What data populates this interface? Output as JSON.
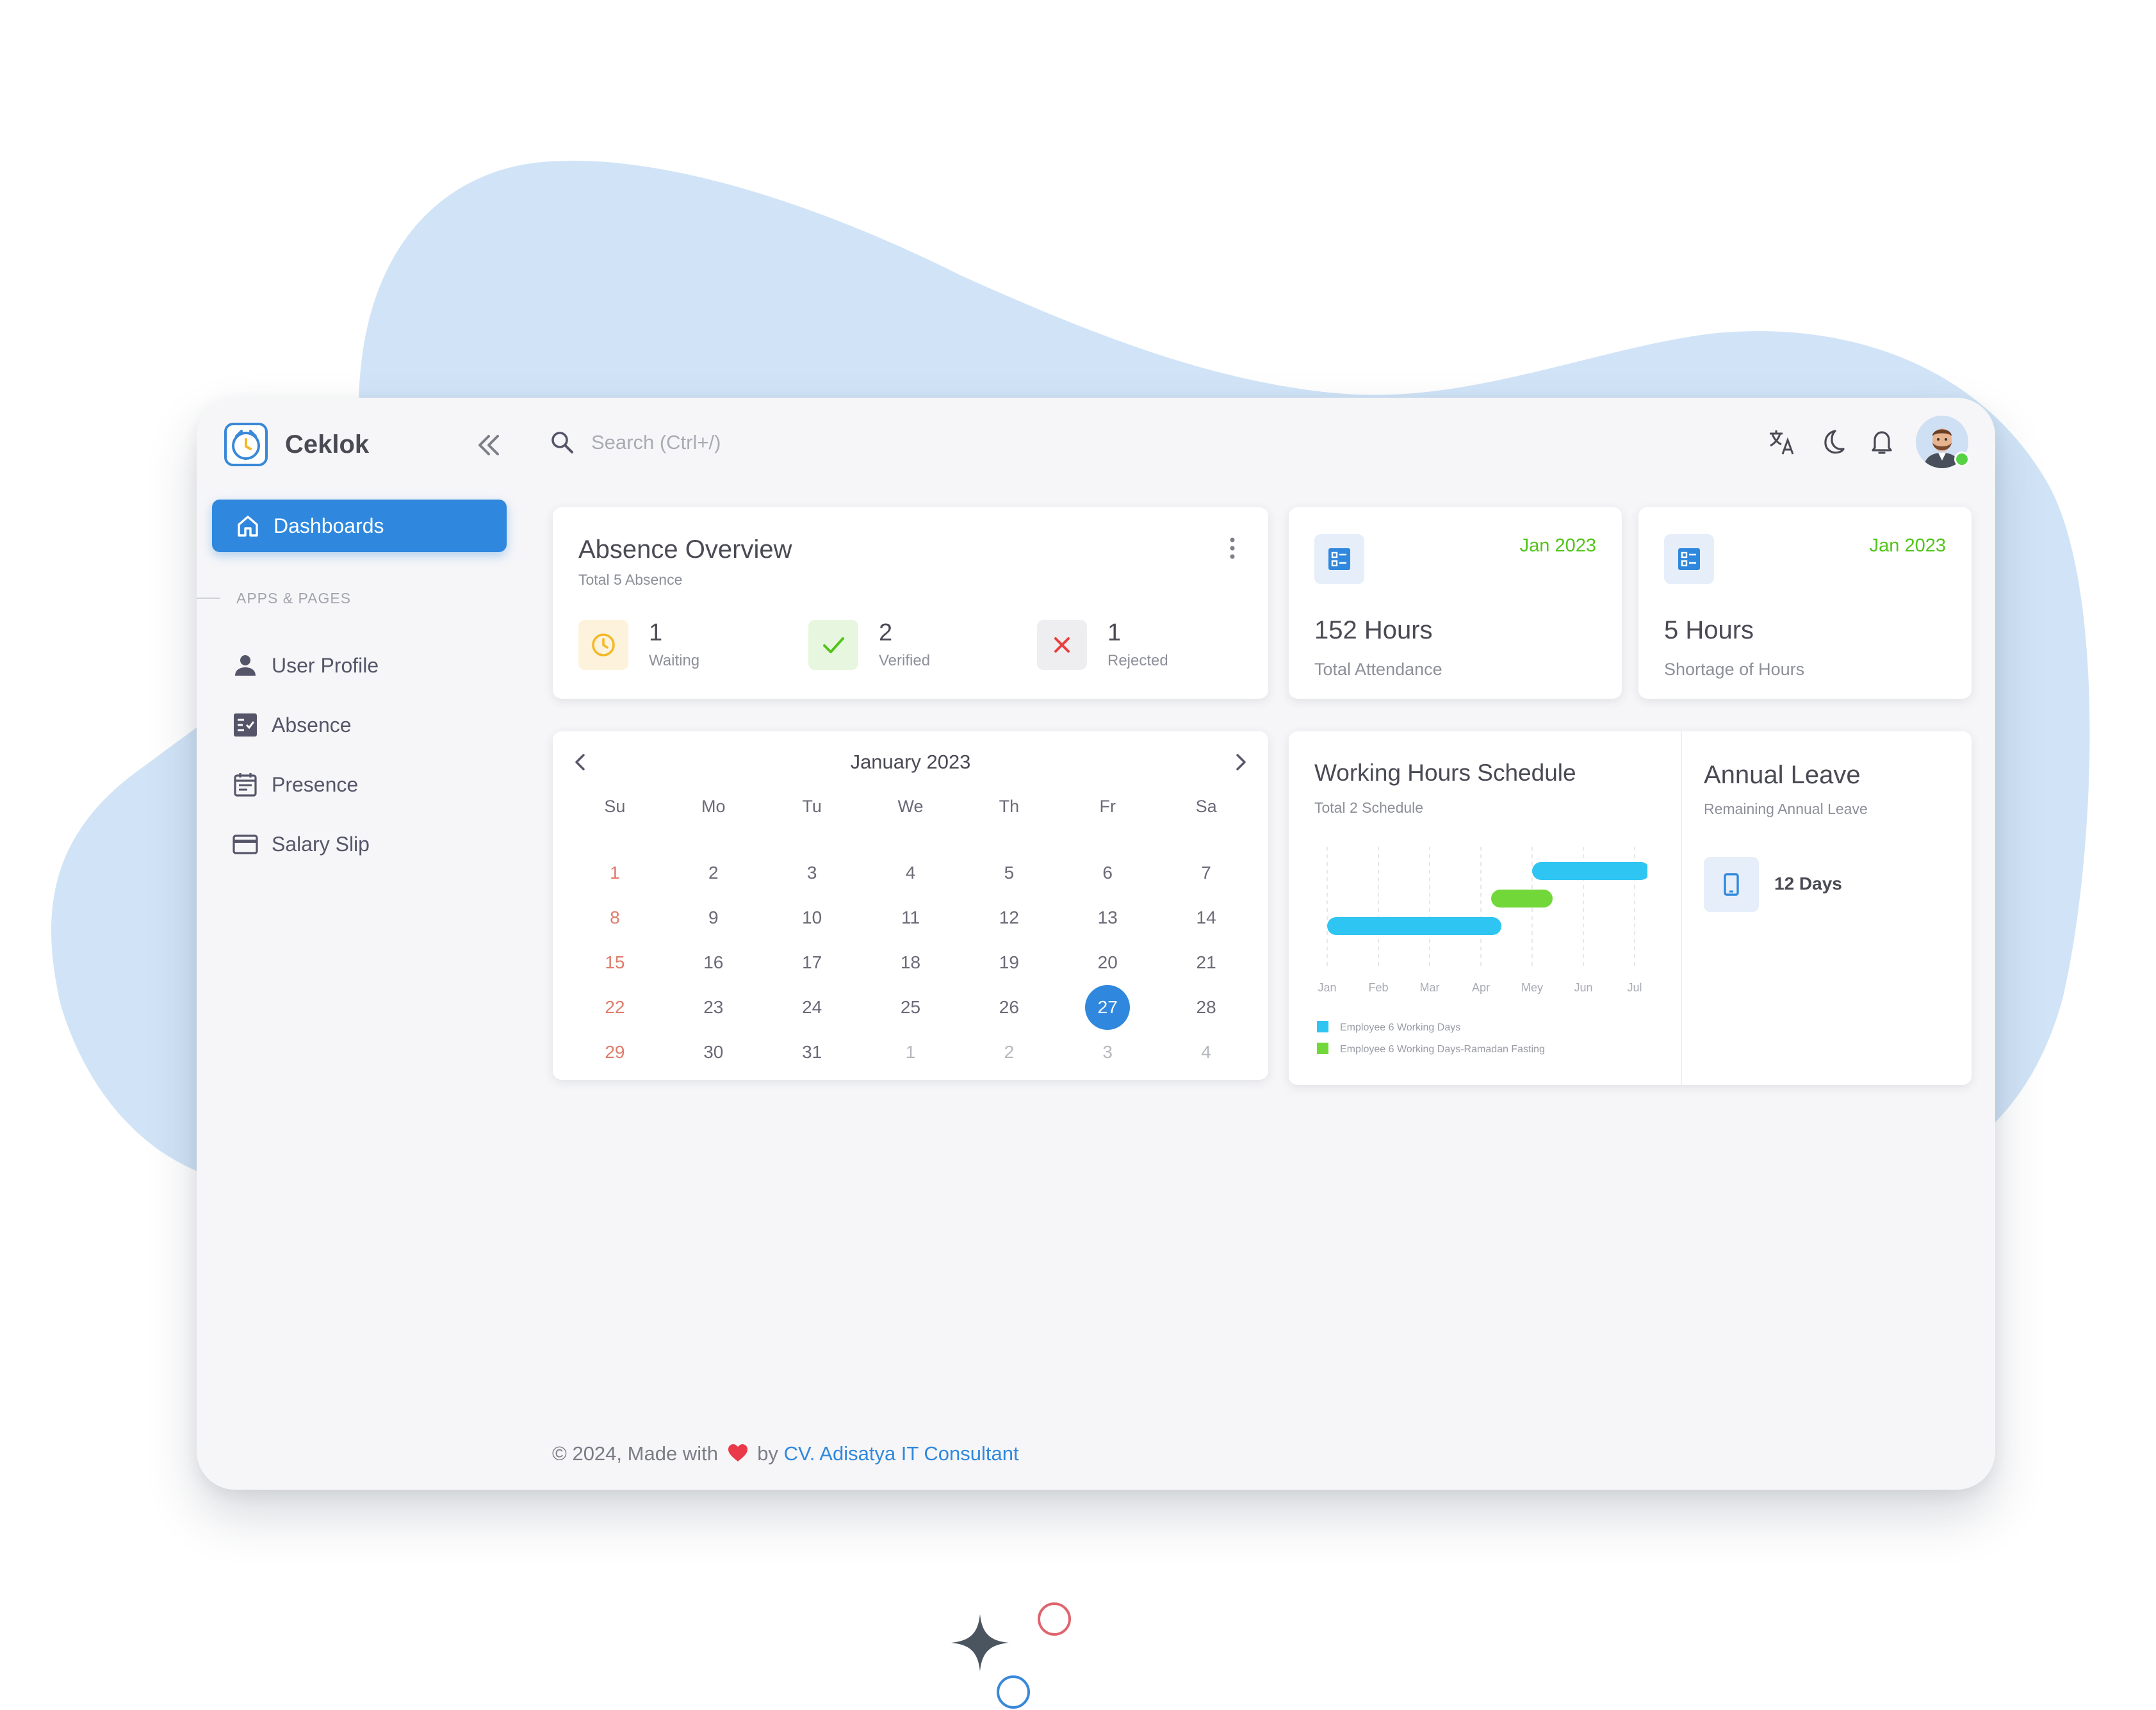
{
  "app": {
    "name": "Ceklok"
  },
  "sidebar": {
    "active_item": "Dashboards",
    "section_header": "APPS & PAGES",
    "items": [
      {
        "label": "User Profile",
        "icon": "user-icon"
      },
      {
        "label": "Absence",
        "icon": "checklist-icon"
      },
      {
        "label": "Presence",
        "icon": "calendar-icon"
      },
      {
        "label": "Salary Slip",
        "icon": "credit-card-icon"
      }
    ]
  },
  "topbar": {
    "search_placeholder": "Search (Ctrl+/)",
    "icons": [
      "translate-icon",
      "moon-icon",
      "bell-icon"
    ]
  },
  "absence_overview": {
    "title": "Absence Overview",
    "subtitle": "Total 5 Absence",
    "stats": [
      {
        "value": "1",
        "label": "Waiting",
        "icon": "clock-icon",
        "color": "#f5b829"
      },
      {
        "value": "2",
        "label": "Verified",
        "icon": "check-icon",
        "color": "#52c41a"
      },
      {
        "value": "1",
        "label": "Rejected",
        "icon": "close-icon",
        "color": "#e8423f"
      }
    ]
  },
  "attendance_card": {
    "date": "Jan 2023",
    "value": "152 Hours",
    "label": "Total Attendance"
  },
  "shortage_card": {
    "date": "Jan 2023",
    "value": "5 Hours",
    "label": "Shortage of Hours"
  },
  "calendar": {
    "title": "January 2023",
    "weekdays": [
      "Su",
      "Mo",
      "Tu",
      "We",
      "Th",
      "Fr",
      "Sa"
    ],
    "weeks": [
      [
        "1",
        "2",
        "3",
        "4",
        "5",
        "6",
        "7"
      ],
      [
        "8",
        "9",
        "10",
        "11",
        "12",
        "13",
        "14"
      ],
      [
        "15",
        "16",
        "17",
        "18",
        "19",
        "20",
        "21"
      ],
      [
        "22",
        "23",
        "24",
        "25",
        "26",
        "27",
        "28"
      ],
      [
        "29",
        "30",
        "31",
        "1",
        "2",
        "3",
        "4"
      ]
    ],
    "selected": "27"
  },
  "schedule": {
    "title": "Working Hours Schedule",
    "subtitle": "Total 2 Schedule",
    "chart_data": {
      "type": "gantt",
      "categories": [
        "Jan",
        "Feb",
        "Mar",
        "Apr",
        "Mey",
        "Jun",
        "Jul"
      ],
      "bars": [
        {
          "series": "Employee 6 Working Days",
          "start": 0,
          "end": 3.4,
          "color": "#2ec5f2"
        },
        {
          "series": "Employee 6 Working Days-Ramadan Fasting",
          "start": 3.2,
          "end": 4.4,
          "color": "#72d83a"
        },
        {
          "series": "Employee 6 Working Days",
          "start": 4.0,
          "end": 6.3,
          "color": "#2ec5f2"
        }
      ],
      "legend": [
        {
          "name": "Employee 6 Working Days",
          "color": "#2ec5f2"
        },
        {
          "name": "Employee 6 Working Days-Ramadan Fasting",
          "color": "#72d83a"
        }
      ]
    }
  },
  "annual_leave": {
    "title": "Annual Leave",
    "subtitle": "Remaining Annual Leave",
    "value": "12 Days"
  },
  "footer": {
    "prefix": "© 2024, Made with",
    "by": "by",
    "company": "CV. Adisatya IT Consultant"
  }
}
